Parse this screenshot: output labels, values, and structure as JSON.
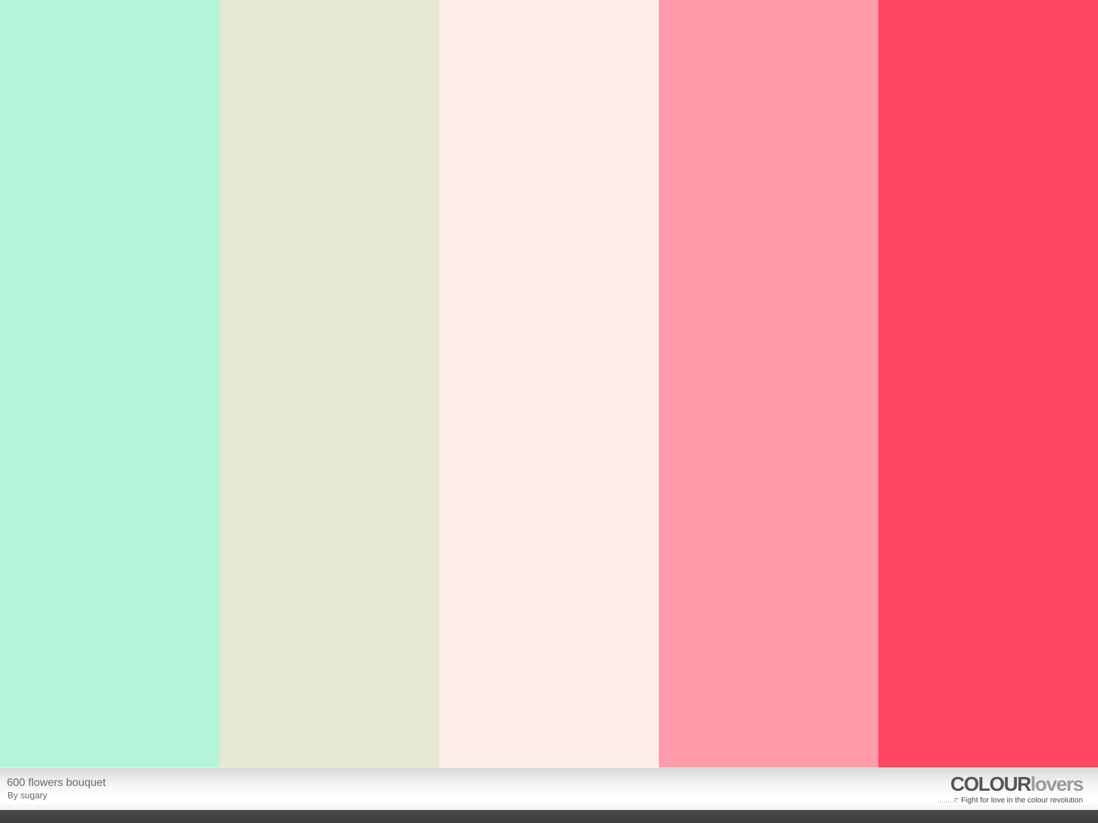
{
  "palette": {
    "title": "600 flowers bouquet",
    "author": "By sugary",
    "colors": [
      "#B4F5DB",
      "#E6E8D4",
      "#FFEDEA",
      "#FF9BAA",
      "#FF4560"
    ]
  },
  "brand": {
    "name_strong": "COLOUR",
    "name_light": "lovers",
    "tagline": "Fight for love in the colour revolution"
  },
  "colors": {
    "footer_text": "#666666",
    "bottom_bar": "#444444"
  }
}
